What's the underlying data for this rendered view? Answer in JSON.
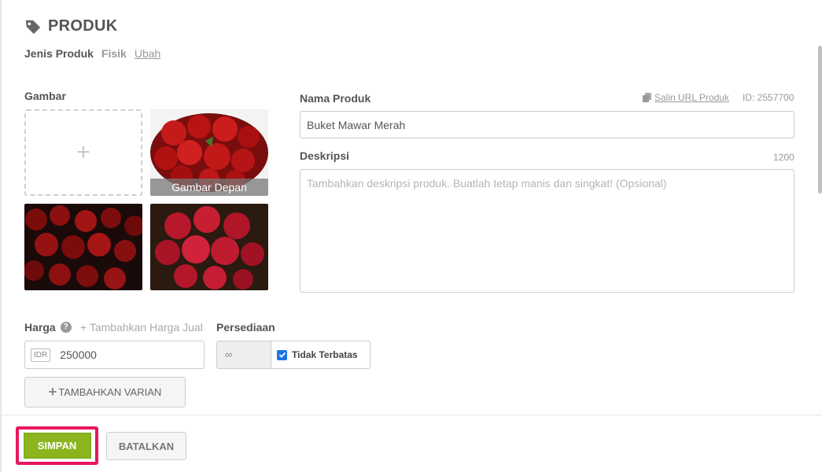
{
  "section": {
    "title": "PRODUK",
    "icon": "tag-icon"
  },
  "product_type": {
    "label": "Jenis Produk",
    "value": "Fisik",
    "change": "Ubah"
  },
  "images": {
    "label": "Gambar",
    "add_symbol": "+",
    "front_caption": "Gambar Depan"
  },
  "name": {
    "label": "Nama Produk",
    "copy_url": "Salin URL Produk",
    "id": "ID: 2557700",
    "value": "Buket Mawar Merah"
  },
  "description": {
    "label": "Deskripsi",
    "counter": "1200",
    "placeholder": "Tambahkan deskripsi produk. Buatlah tetap manis dan singkat! (Opsional)"
  },
  "price": {
    "label": "Harga",
    "help": "?",
    "add_sale_price": "+ Tambahkan Harga Jual",
    "currency": "IDR",
    "value": "250000"
  },
  "stock": {
    "label": "Persediaan",
    "infinity": "∞",
    "unlimited_label": "Tidak Terbatas",
    "unlimited_checked": true
  },
  "variant_button": {
    "label": "TAMBAHKAN VARIAN",
    "plus": "+"
  },
  "actions": {
    "save": "SIMPAN",
    "cancel": "BATALKAN"
  },
  "colors": {
    "save": "#8ab51e",
    "highlight": "#e8175d",
    "checkbox": "#1a73e8"
  }
}
